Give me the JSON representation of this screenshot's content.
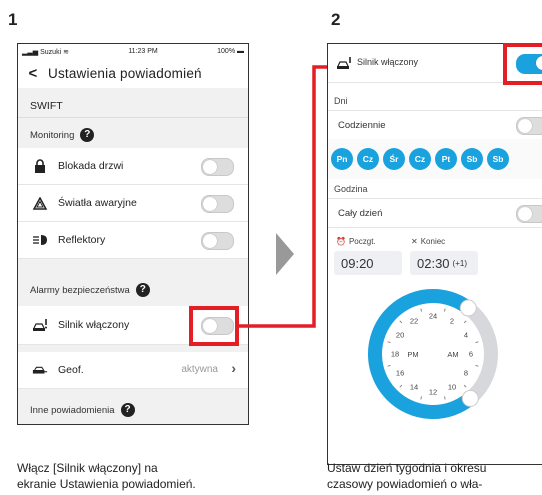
{
  "steps": {
    "one": "1",
    "two": "2"
  },
  "colors": {
    "accent": "#1aa2df",
    "highlight": "#e31e24",
    "arrow": "#999999"
  },
  "phone1": {
    "status": {
      "carrier": "Suzuki",
      "time": "11:23 PM",
      "battery": "100%"
    },
    "title": "Ustawienia powiadomień",
    "section": "SWIFT",
    "monitoring_header": "Monitoring",
    "rows": [
      {
        "label": "Blokada drzwi",
        "icon": "lock-icon",
        "on": false
      },
      {
        "label": "Światła awaryjne",
        "icon": "hazard-icon",
        "on": false
      },
      {
        "label": "Reflektory",
        "icon": "headlight-icon",
        "on": false
      }
    ],
    "alarms_header": "Alarmy bezpieczeństwa",
    "engine": {
      "label": "Silnik włączony",
      "icon": "car-engine-icon",
      "on": false
    },
    "geof": {
      "label": "Geof.",
      "value": "aktywna",
      "icon": "geofence-icon"
    },
    "other_header": "Inne powiadomienia"
  },
  "phone2": {
    "engine_label": "Silnik włączony",
    "days_label": "Dni",
    "daily_label": "Codziennie",
    "days": [
      "Pn",
      "Cz",
      "Śr",
      "Cz",
      "Pt",
      "Sb",
      "Sb"
    ],
    "hour_label": "Godzina",
    "allday_label": "Cały dzień",
    "start_label": "Poczgt.",
    "end_label": "Koniec",
    "start_time": "09:20",
    "end_time": "02:30",
    "end_suffix": "(+1)",
    "clock": {
      "labels": [
        "24",
        "22",
        "2",
        "20",
        "4",
        "18",
        "6",
        "16",
        "8",
        "14",
        "10",
        "12"
      ],
      "pm": "PM",
      "am": "AM"
    }
  },
  "captions": {
    "left": [
      "Włącz [Silnik włączony] na",
      "ekranie Ustawienia powiadomień."
    ],
    "right": [
      "Ustaw dzień tygodnia i okresu",
      "czasowy powiadomień o wła-"
    ]
  }
}
